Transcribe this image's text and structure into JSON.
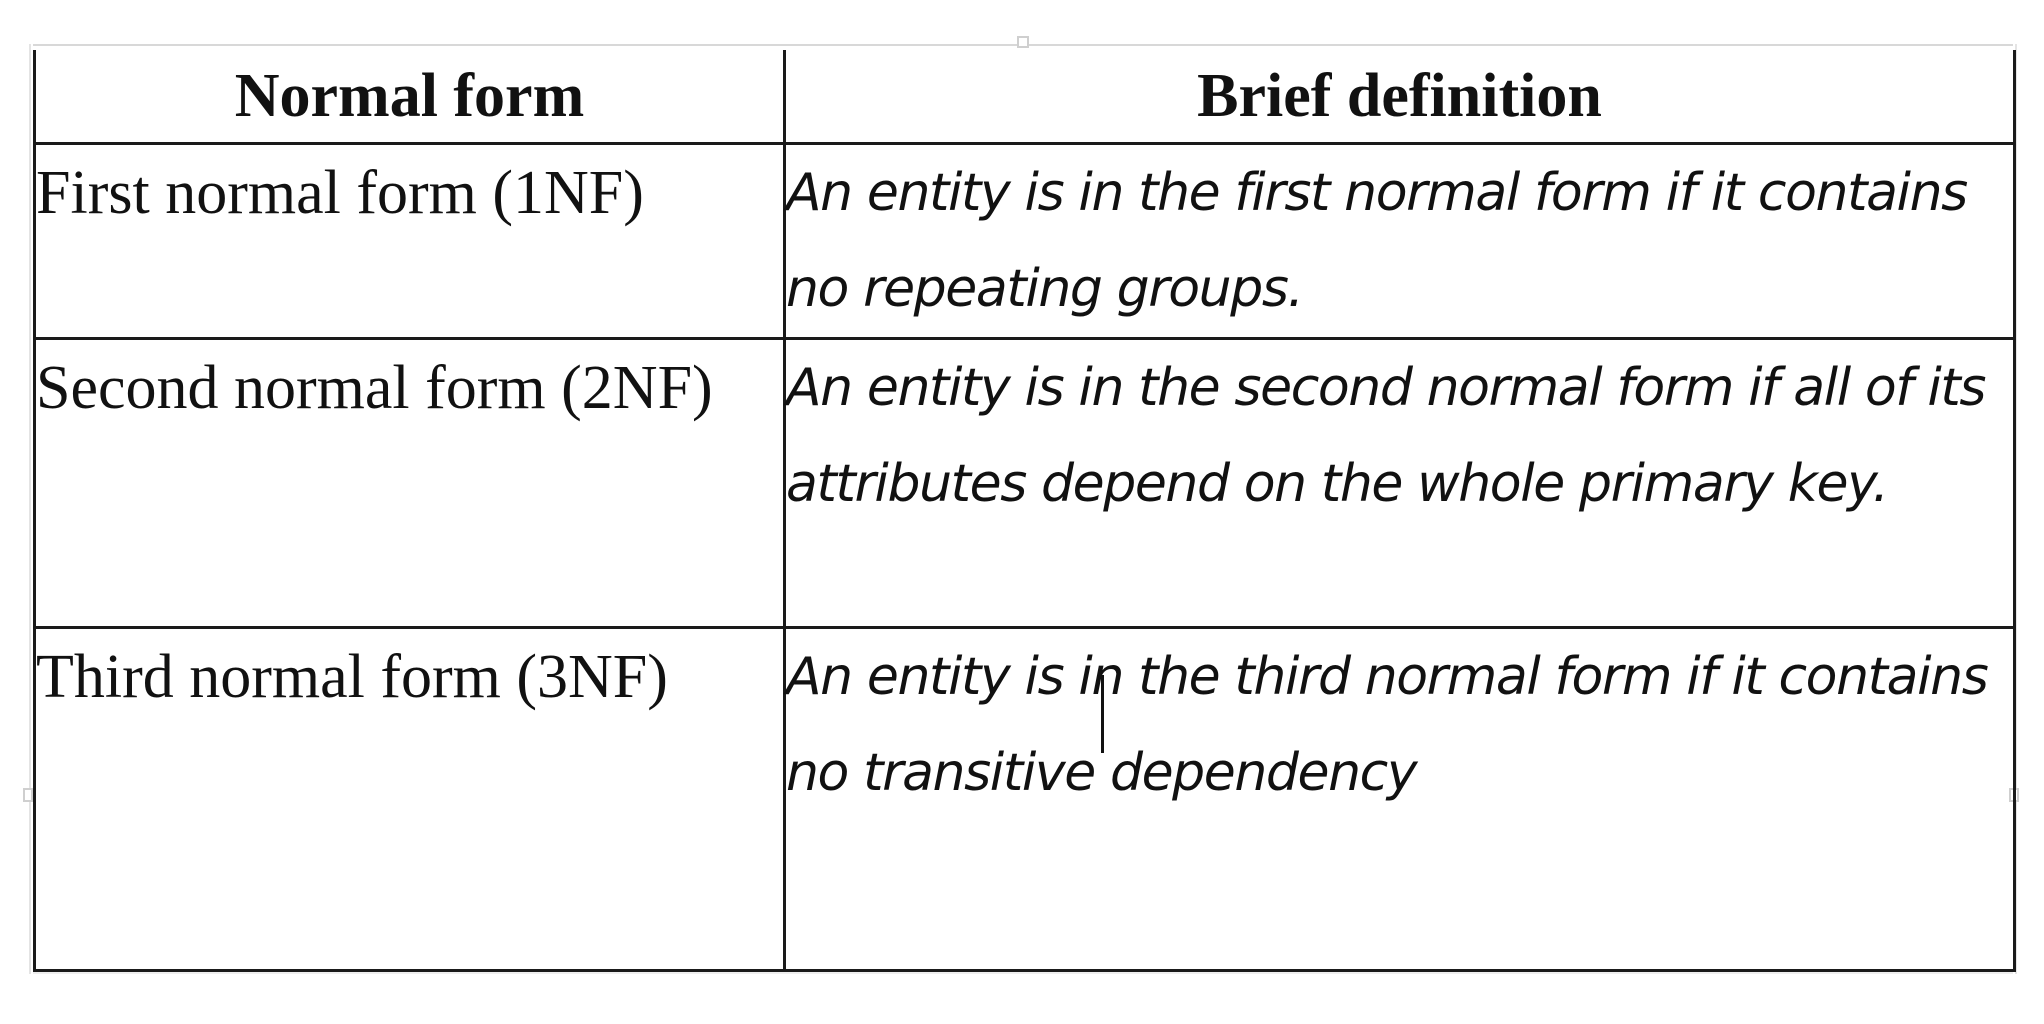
{
  "table": {
    "headers": [
      "Normal form",
      "Brief definition"
    ],
    "rows": [
      {
        "name": "First normal form (1NF)",
        "definition": "An entity is in the first normal form if it contains no repeating groups."
      },
      {
        "name": "Second normal form (2NF)",
        "definition": "An entity is in the second normal form if all of its attributes depend on the whole primary key."
      },
      {
        "name": "Third normal form (3NF)",
        "definition": "An entity is in the third normal form if it contains no transitive dependency"
      }
    ]
  },
  "colors": {
    "border": "#1a1a1a",
    "text": "#111111",
    "background": "#ffffff"
  }
}
